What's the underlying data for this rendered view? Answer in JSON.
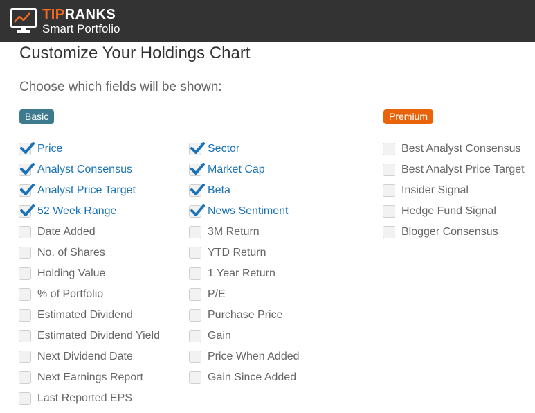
{
  "header": {
    "brand_part1": "TIP",
    "brand_part2": "RANKS",
    "product": "Smart Portfolio",
    "logo_icon": "monitor-chart-icon",
    "colors": {
      "bar": "#333333",
      "brand_accent": "#f26a21"
    }
  },
  "page": {
    "title": "Customize Your Holdings Chart",
    "subtitle": "Choose which fields will be shown:"
  },
  "sections": {
    "basic": {
      "label": "Basic",
      "color": "#3d7a8e"
    },
    "premium": {
      "label": "Premium",
      "color": "#e8630a"
    }
  },
  "columns": [
    [
      {
        "label": "Price",
        "checked": true
      },
      {
        "label": "Analyst Consensus",
        "checked": true
      },
      {
        "label": "Analyst Price Target",
        "checked": true
      },
      {
        "label": "52 Week Range",
        "checked": true
      },
      {
        "label": "Date Added",
        "checked": false
      },
      {
        "label": "No. of Shares",
        "checked": false
      },
      {
        "label": "Holding Value",
        "checked": false
      },
      {
        "label": "% of Portfolio",
        "checked": false
      },
      {
        "label": "Estimated Dividend",
        "checked": false
      },
      {
        "label": "Estimated Dividend Yield",
        "checked": false
      },
      {
        "label": "Next Dividend Date",
        "checked": false
      },
      {
        "label": "Next Earnings Report",
        "checked": false
      },
      {
        "label": "Last Reported EPS",
        "checked": false
      }
    ],
    [
      {
        "label": "Sector",
        "checked": true
      },
      {
        "label": "Market Cap",
        "checked": true
      },
      {
        "label": "Beta",
        "checked": true
      },
      {
        "label": "News Sentiment",
        "checked": true
      },
      {
        "label": "3M Return",
        "checked": false
      },
      {
        "label": "YTD Return",
        "checked": false
      },
      {
        "label": "1 Year Return",
        "checked": false
      },
      {
        "label": "P/E",
        "checked": false
      },
      {
        "label": "Purchase Price",
        "checked": false
      },
      {
        "label": "Gain",
        "checked": false
      },
      {
        "label": "Price When Added",
        "checked": false
      },
      {
        "label": "Gain Since Added",
        "checked": false
      }
    ],
    [
      {
        "label": "Best Analyst Consensus",
        "checked": false
      },
      {
        "label": "Best Analyst Price Target",
        "checked": false
      },
      {
        "label": "Insider Signal",
        "checked": false
      },
      {
        "label": "Hedge Fund Signal",
        "checked": false
      },
      {
        "label": "Blogger Consensus",
        "checked": false
      }
    ]
  ],
  "check_icon": "checkmark-icon",
  "check_color": "#1a73b8"
}
